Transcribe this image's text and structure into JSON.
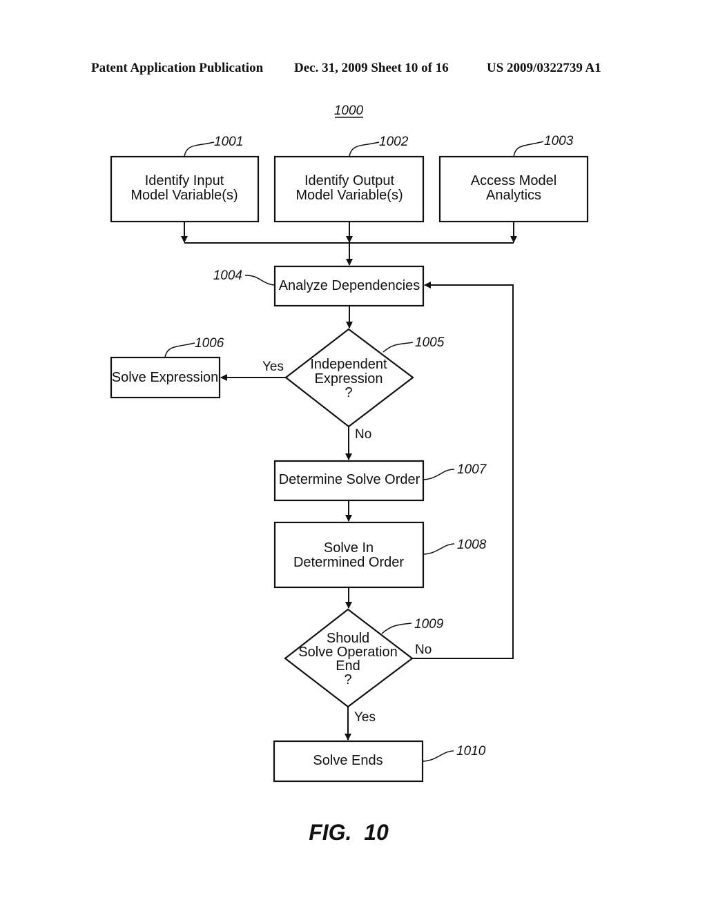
{
  "header": {
    "publication": "Patent Application Publication",
    "date_sheet": "Dec. 31, 2009   Sheet 10 of 16",
    "number": "US 2009/0322739 A1"
  },
  "diagram": {
    "id": "1000",
    "figure_label": "FIG.  10",
    "nodes": {
      "n1001": {
        "ref": "1001",
        "line1": "Identify Input",
        "line2": "Model Variable(s)"
      },
      "n1002": {
        "ref": "1002",
        "line1": "Identify Output",
        "line2": "Model Variable(s)"
      },
      "n1003": {
        "ref": "1003",
        "line1": "Access Model",
        "line2": "Analytics"
      },
      "n1004": {
        "ref": "1004",
        "line1": "Analyze Dependencies"
      },
      "n1005": {
        "ref": "1005",
        "line1": "Independent",
        "line2": "Expression",
        "line3": "?"
      },
      "n1006": {
        "ref": "1006",
        "line1": "Solve Expression"
      },
      "n1007": {
        "ref": "1007",
        "line1": "Determine Solve Order"
      },
      "n1008": {
        "ref": "1008",
        "line1": "Solve In",
        "line2": "Determined Order"
      },
      "n1009": {
        "ref": "1009",
        "line1": "Should",
        "line2": "Solve Operation",
        "line3": "End",
        "line4": "?"
      },
      "n1010": {
        "ref": "1010",
        "line1": "Solve Ends"
      }
    },
    "edges": {
      "e1005_yes": "Yes",
      "e1005_no": "No",
      "e1009_no": "No",
      "e1009_yes": "Yes"
    }
  }
}
